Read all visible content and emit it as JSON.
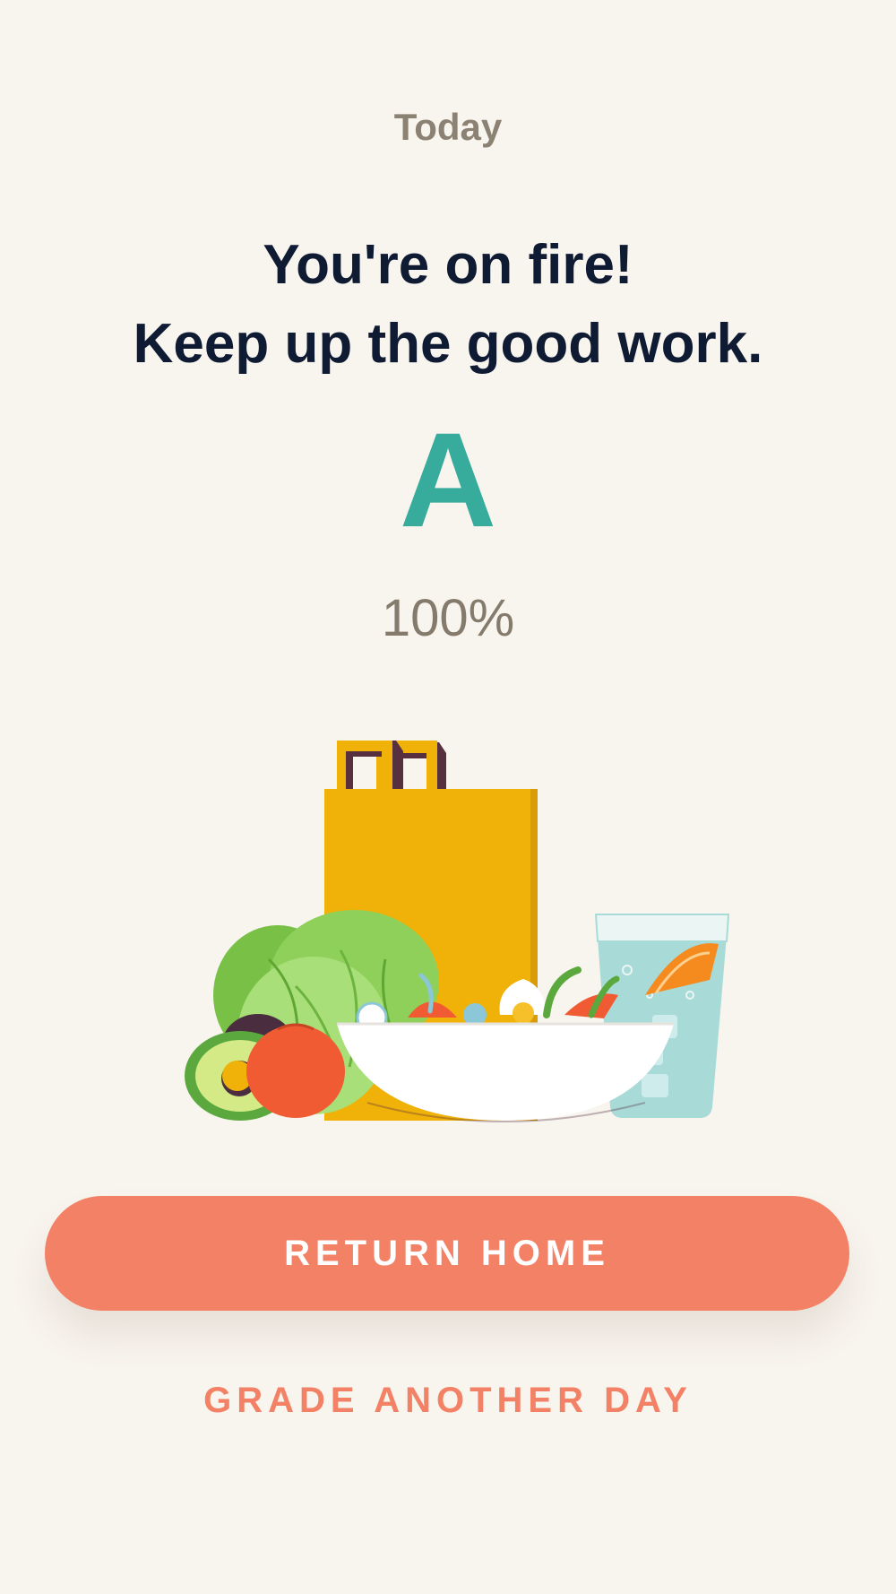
{
  "header": {
    "label": "Today"
  },
  "result": {
    "headline_line1": "You're on fire!",
    "headline_line2": "Keep up the good work.",
    "grade": "A",
    "percent": "100%",
    "percent_value": 100
  },
  "actions": {
    "primary_label": "RETURN HOME",
    "secondary_label": "GRADE ANOTHER DAY"
  },
  "colors": {
    "background": "#f8f4ee",
    "accent": "#f38166",
    "grade": "#37ab9c",
    "headline": "#0f1a33",
    "muted": "#857b6d"
  },
  "icons": {
    "illustration": "grocery-bag-salad-illustration"
  }
}
